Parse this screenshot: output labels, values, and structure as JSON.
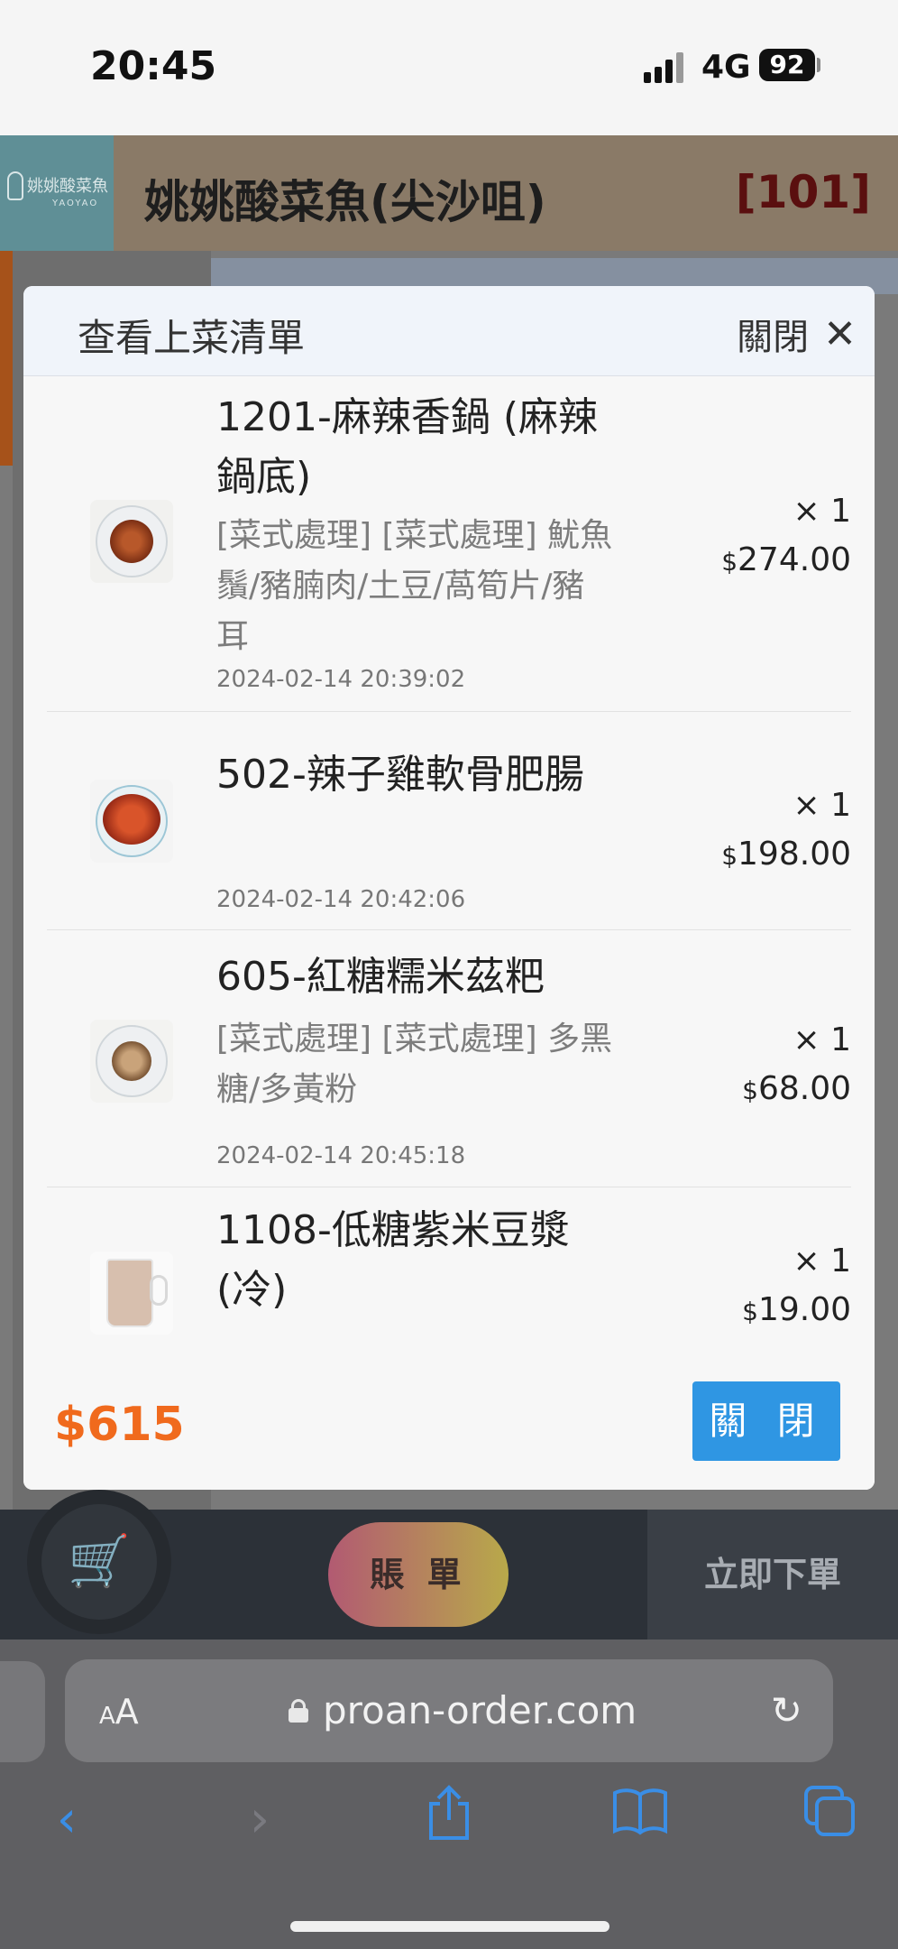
{
  "status_bar": {
    "time": "20:45",
    "network": "4G",
    "battery": "92"
  },
  "shop": {
    "logo_text": "姚姚酸菜魚",
    "logo_sub": "YAOYAO",
    "name": "姚姚酸菜魚(尖沙咀)",
    "table": "[101]"
  },
  "modal": {
    "title": "查看上菜清單",
    "close_top_label": "關閉",
    "items": [
      {
        "name": "1201-麻辣香鍋 (麻辣鍋底)",
        "options": "[菜式處理] [菜式處理] 魷魚鬚/豬腩肉/土豆/萵筍片/豬耳",
        "time": "2024-02-14 20:39:02",
        "qty": "× 1",
        "currency": "$",
        "price": "274.00",
        "image": "spicy-pot-dish"
      },
      {
        "name": "502-辣子雞軟骨肥腸",
        "options": "",
        "time": "2024-02-14 20:42:06",
        "qty": "× 1",
        "currency": "$",
        "price": "198.00",
        "image": "chili-chicken-dish"
      },
      {
        "name": "605-紅糖糯米茲粑",
        "options": "[菜式處理] [菜式處理] 多黑糖/多黃粉",
        "time": "2024-02-14 20:45:18",
        "qty": "× 1",
        "currency": "$",
        "price": "68.00",
        "image": "brown-sugar-rice-cake"
      },
      {
        "name": "1108-低糖紫米豆漿(冷)",
        "options": "",
        "time": "",
        "qty": "× 1",
        "currency": "$",
        "price": "19.00",
        "image": "soy-milk-cup"
      }
    ],
    "total": "$615",
    "close_button_label": "關 閉"
  },
  "bottom_bar": {
    "cart_icon": "cart-icon",
    "bill_label": "賬 單",
    "order_now_label": "立即下單"
  },
  "browser": {
    "aa_label": "AA",
    "url": "proan-order.com"
  }
}
